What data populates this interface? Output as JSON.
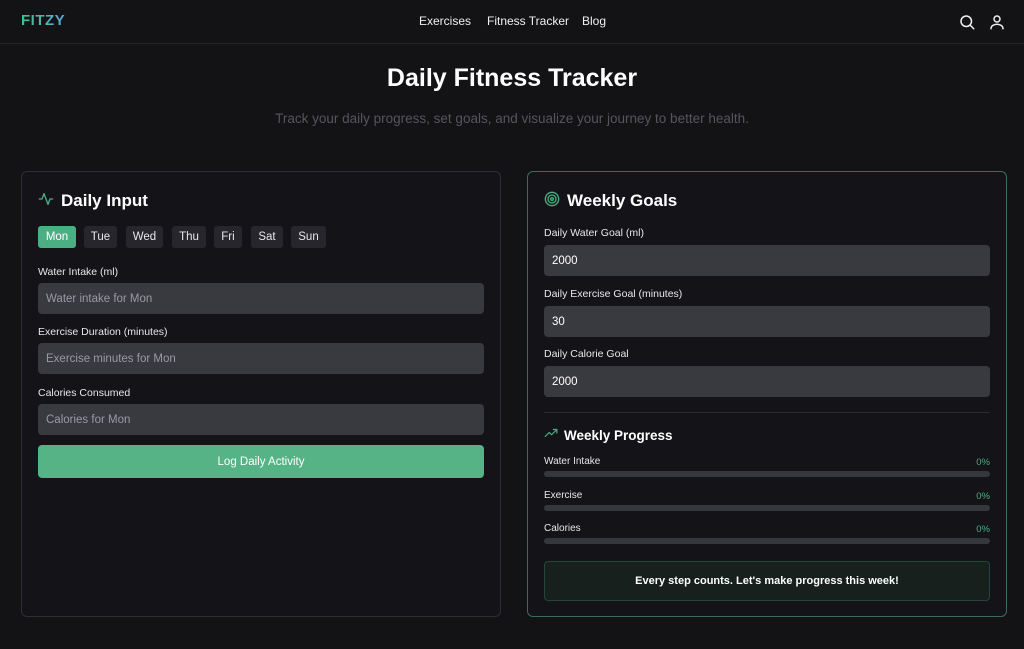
{
  "header": {
    "logo": "FITZY",
    "nav": [
      "Exercises",
      "Fitness Tracker",
      "Blog"
    ],
    "icons": [
      "search-icon",
      "user-icon"
    ]
  },
  "hero": {
    "title": "Daily Fitness Tracker",
    "subtitle": "Track your daily progress, set goals, and visualize your journey to better health."
  },
  "daily_input": {
    "title": "Daily Input",
    "icon": "activity-icon",
    "days": [
      "Mon",
      "Tue",
      "Wed",
      "Thu",
      "Fri",
      "Sat",
      "Sun"
    ],
    "selected_day": "Mon",
    "water_label": "Water Intake (ml)",
    "water_placeholder": "Water intake for Mon",
    "exercise_label": "Exercise Duration (minutes)",
    "exercise_placeholder": "Exercise minutes for Mon",
    "calories_label": "Calories Consumed",
    "calories_placeholder": "Calories for Mon",
    "submit_label": "Log Daily Activity"
  },
  "weekly_goals": {
    "title": "Weekly Goals",
    "icon": "target-icon",
    "water_goal_label": "Daily Water Goal (ml)",
    "water_goal_value": "2000",
    "exercise_goal_label": "Daily Exercise Goal (minutes)",
    "exercise_goal_value": "30",
    "calorie_goal_label": "Daily Calorie Goal",
    "calorie_goal_value": "2000"
  },
  "weekly_progress": {
    "title": "Weekly Progress",
    "icon": "trending-up-icon",
    "items": [
      {
        "label": "Water Intake",
        "percent_text": "0%",
        "percent": 0
      },
      {
        "label": "Exercise",
        "percent_text": "0%",
        "percent": 0
      },
      {
        "label": "Calories",
        "percent_text": "0%",
        "percent": 0
      }
    ],
    "message": "Every step counts. Let's make progress this week!"
  },
  "colors": {
    "accent": "#4caf83",
    "background": "#131316",
    "card": "#141418",
    "input": "#393940"
  }
}
